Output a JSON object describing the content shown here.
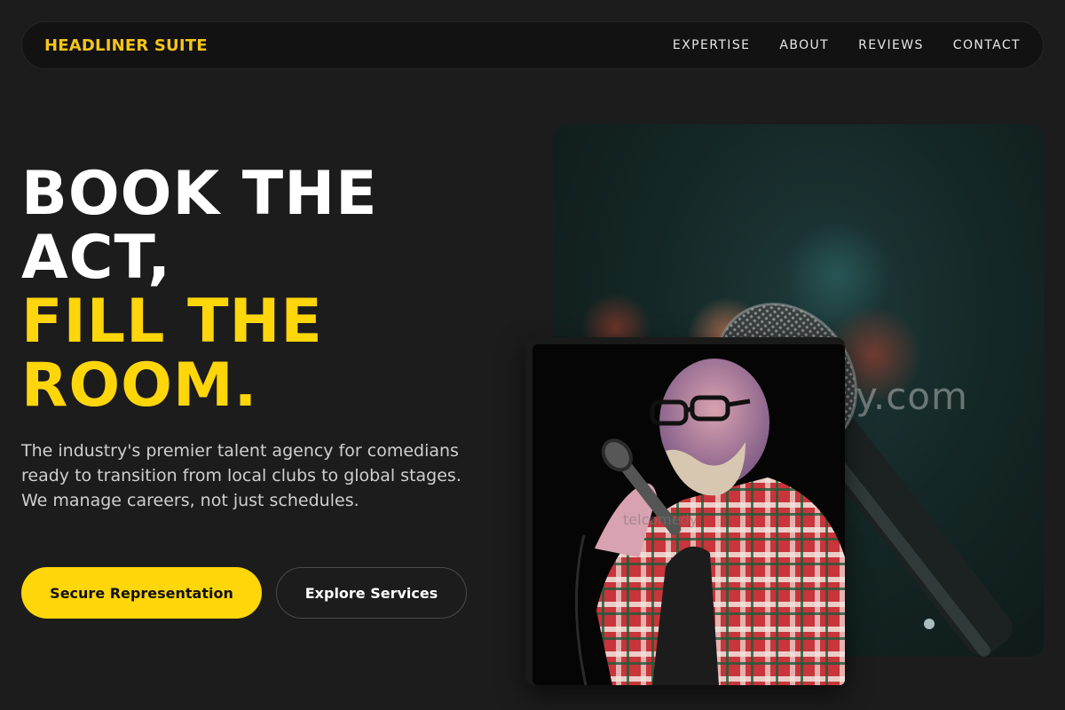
{
  "brand": "HEADLINER SUITE",
  "nav": [
    "EXPERTISE",
    "ABOUT",
    "REVIEWS",
    "CONTACT"
  ],
  "hero": {
    "headline_white": [
      "BOOK THE",
      "ACT,"
    ],
    "headline_yellow": [
      "FILL THE",
      "ROOM."
    ],
    "subtext": "The industry's premier talent agency for comedians ready to transition from local clubs to global stages. We manage careers, not just schedules.",
    "primary_cta": "Secure Representation",
    "secondary_cta": "Explore Services"
  },
  "images": {
    "background_watermark": "y.com",
    "foreground_watermark": "telcomedy"
  },
  "colors": {
    "accent": "#ffd60a",
    "background": "#1c1c1c",
    "nav_background": "#121212"
  }
}
